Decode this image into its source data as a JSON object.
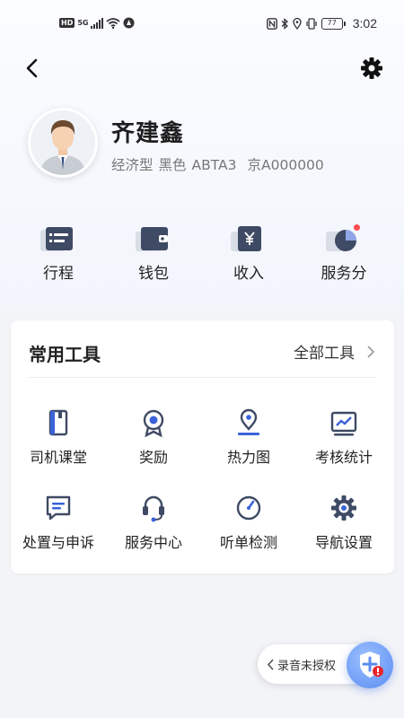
{
  "status_bar": {
    "hd": "HD",
    "network": "5G",
    "battery": "77",
    "time": "3:02"
  },
  "profile": {
    "name": "齐建鑫",
    "car_type": "经济型",
    "car_color": "黑色",
    "car_model": "ABTA3",
    "plate": "京A000000"
  },
  "quick_actions": [
    {
      "label": "行程",
      "icon": "itinerary-icon"
    },
    {
      "label": "钱包",
      "icon": "wallet-icon"
    },
    {
      "label": "收入",
      "icon": "income-icon"
    },
    {
      "label": "服务分",
      "icon": "service-score-icon"
    }
  ],
  "tools": {
    "title": "常用工具",
    "all_label": "全部工具",
    "items": [
      {
        "label": "司机课堂",
        "icon": "driver-class-icon"
      },
      {
        "label": "奖励",
        "icon": "reward-icon"
      },
      {
        "label": "热力图",
        "icon": "heatmap-icon"
      },
      {
        "label": "考核统计",
        "icon": "stats-icon"
      },
      {
        "label": "处置与申诉",
        "icon": "appeal-icon"
      },
      {
        "label": "服务中心",
        "icon": "service-center-icon"
      },
      {
        "label": "听单检测",
        "icon": "order-detect-icon"
      },
      {
        "label": "导航设置",
        "icon": "nav-settings-icon"
      }
    ]
  },
  "floating": {
    "recording_label": "录音未授权"
  },
  "colors": {
    "accent": "#3a63d8",
    "icon_dark": "#3f4a64",
    "badge_red": "#ff4d4f"
  }
}
